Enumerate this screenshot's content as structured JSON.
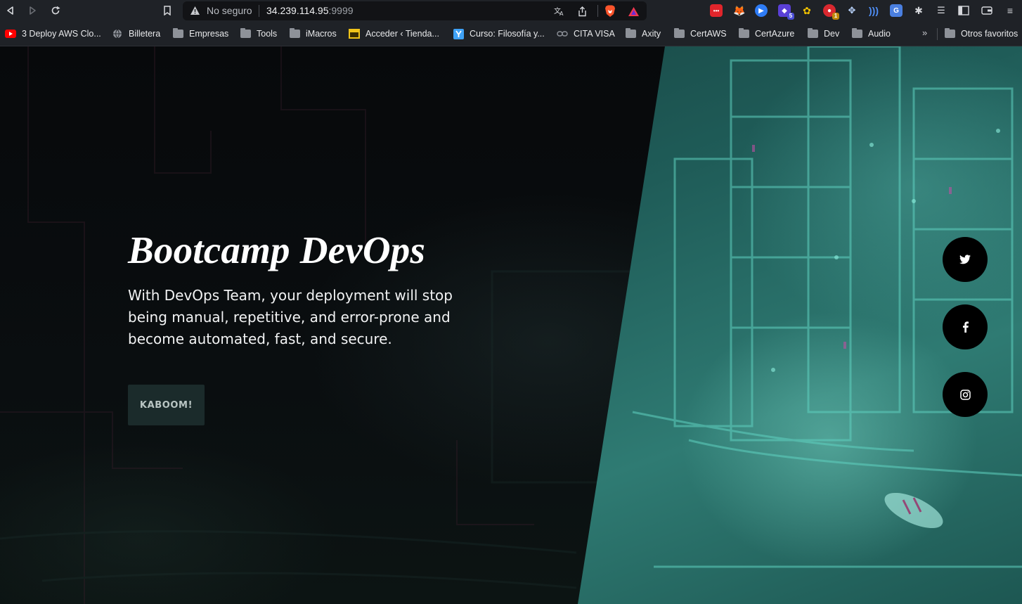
{
  "browser": {
    "address_bar": {
      "security_label": "No seguro",
      "url_host": "34.239.114.95",
      "url_port": ":9999"
    },
    "extension_badges": {
      "ext_blue": "5",
      "ext_red": "1"
    },
    "bookmarks": [
      {
        "label": "3 Deploy AWS Clo...",
        "icon": "youtube-icon"
      },
      {
        "label": "Billetera",
        "icon": "globe-icon"
      },
      {
        "label": "Empresas",
        "icon": "folder-icon"
      },
      {
        "label": "Tools",
        "icon": "folder-icon"
      },
      {
        "label": "iMacros",
        "icon": "folder-icon"
      },
      {
        "label": "Acceder ‹ Tienda...",
        "icon": "site-icon"
      },
      {
        "label": "Curso: Filosofía y...",
        "icon": "y-icon"
      },
      {
        "label": "CITA VISA",
        "icon": "link-icon"
      },
      {
        "label": "Axity",
        "icon": "folder-icon"
      },
      {
        "label": "CertAWS",
        "icon": "folder-icon"
      },
      {
        "label": "CertAzure",
        "icon": "folder-icon"
      },
      {
        "label": "Dev",
        "icon": "folder-icon"
      },
      {
        "label": "Audio",
        "icon": "folder-icon"
      }
    ],
    "more_bookmarks": "»",
    "other_favorites": "Otros favoritos"
  },
  "hero": {
    "title": "Bootcamp DevOps",
    "description": "With DevOps Team, your deployment will stop being manual, repetitive, and error-prone and become automated, fast, and secure.",
    "cta_label": "KABOOM!"
  },
  "social": [
    {
      "name": "twitter-icon"
    },
    {
      "name": "facebook-icon"
    },
    {
      "name": "instagram-icon"
    }
  ],
  "colors": {
    "page_bg": "#07090b",
    "accent_teal": "#2f7b73",
    "button_bg": "#1b2b2b",
    "social_bg": "#000000"
  }
}
